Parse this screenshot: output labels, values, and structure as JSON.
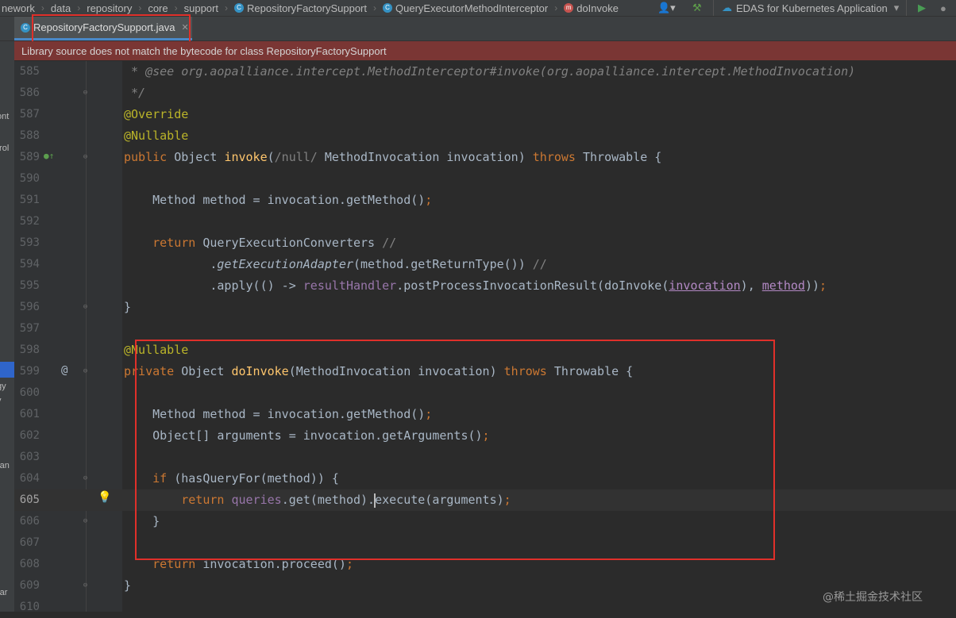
{
  "breadcrumbs": [
    "nework",
    "data",
    "repository",
    "core",
    "support",
    "RepositoryFactorySupport",
    "QueryExecutorMethodInterceptor",
    "doInvoke"
  ],
  "toolbar": {
    "run_config": "EDAS for Kubernetes Application"
  },
  "tab": {
    "label": "RepositoryFactorySupport.java"
  },
  "warning": "Library source does not match the bytecode for class RepositoryFactorySupport",
  "left_strip": [
    "ont",
    "trol",
    "gy",
    "y",
    "ran",
    "rar"
  ],
  "watermark": "@稀土掘金技术社区",
  "lines": [
    {
      "n": "585",
      "t": [
        [
          " * @see org.aopalliance.intercept.MethodInterceptor#invoke(org.aopalliance.intercept.MethodInvocation)",
          "cm it"
        ]
      ]
    },
    {
      "n": "586",
      "t": [
        [
          " */",
          "cm it"
        ]
      ]
    },
    {
      "n": "587",
      "t": [
        [
          "@Override",
          "ann"
        ]
      ]
    },
    {
      "n": "588",
      "t": [
        [
          "@Nullable",
          "ann"
        ]
      ]
    },
    {
      "n": "589",
      "t": [
        [
          "public ",
          "kw"
        ],
        [
          "Object ",
          ""
        ],
        [
          "invoke",
          "fn"
        ],
        [
          "(",
          ""
        ],
        [
          "/null/",
          "cm"
        ],
        [
          " MethodInvocation invocation) ",
          ""
        ],
        [
          "throws ",
          "kw"
        ],
        [
          "Throwable {",
          ""
        ]
      ]
    },
    {
      "n": "590",
      "t": []
    },
    {
      "n": "591",
      "t": [
        [
          "    Method method = invocation.getMethod()",
          ""
        ],
        [
          ";",
          "semi"
        ]
      ]
    },
    {
      "n": "592",
      "t": []
    },
    {
      "n": "593",
      "t": [
        [
          "    return ",
          "kw"
        ],
        [
          "QueryExecutionConverters ",
          ""
        ],
        [
          "//",
          "cm"
        ]
      ]
    },
    {
      "n": "594",
      "t": [
        [
          "            .",
          ""
        ],
        [
          "getExecutionAdapter",
          "it"
        ],
        [
          "(method.getReturnType()) ",
          ""
        ],
        [
          "//",
          "cm"
        ]
      ]
    },
    {
      "n": "595",
      "t": [
        [
          "            .apply(() -> ",
          ""
        ],
        [
          "resultHandler",
          "fld"
        ],
        [
          ".postProcessInvocationResult(doInvoke(",
          ""
        ],
        [
          "invocation",
          "param"
        ],
        [
          "), ",
          ""
        ],
        [
          "method",
          "param"
        ],
        [
          "))",
          ""
        ],
        [
          ";",
          "semi"
        ]
      ]
    },
    {
      "n": "596",
      "t": [
        [
          "}",
          ""
        ]
      ]
    },
    {
      "n": "597",
      "t": []
    },
    {
      "n": "598",
      "t": [
        [
          "@Nullable",
          "ann"
        ]
      ]
    },
    {
      "n": "599",
      "t": [
        [
          "private ",
          "kw"
        ],
        [
          "Object ",
          ""
        ],
        [
          "doInvoke",
          "fn"
        ],
        [
          "(MethodInvocation invocation) ",
          ""
        ],
        [
          "throws ",
          "kw"
        ],
        [
          "Throwable {",
          ""
        ]
      ]
    },
    {
      "n": "600",
      "t": []
    },
    {
      "n": "601",
      "t": [
        [
          "    Method method = invocation.getMethod()",
          ""
        ],
        [
          ";",
          "semi"
        ]
      ]
    },
    {
      "n": "602",
      "t": [
        [
          "    Object[] arguments = invocation.getArguments()",
          ""
        ],
        [
          ";",
          "semi"
        ]
      ]
    },
    {
      "n": "603",
      "t": []
    },
    {
      "n": "604",
      "t": [
        [
          "    if ",
          "kw"
        ],
        [
          "(hasQueryFor(method)) {",
          ""
        ]
      ]
    },
    {
      "n": "605",
      "t": [
        [
          "        return ",
          "kw"
        ],
        [
          "queries",
          "fld"
        ],
        [
          ".get(method).",
          ""
        ],
        [
          "|",
          "caret"
        ],
        [
          "execute(arguments)",
          ""
        ],
        [
          ";",
          "semi"
        ]
      ]
    },
    {
      "n": "606",
      "t": [
        [
          "    }",
          ""
        ]
      ]
    },
    {
      "n": "607",
      "t": []
    },
    {
      "n": "608",
      "t": [
        [
          "    return ",
          "kw"
        ],
        [
          "invocation.proceed()",
          ""
        ],
        [
          ";",
          "semi"
        ]
      ]
    },
    {
      "n": "609",
      "t": [
        [
          "}",
          ""
        ]
      ]
    },
    {
      "n": "610",
      "t": []
    }
  ]
}
